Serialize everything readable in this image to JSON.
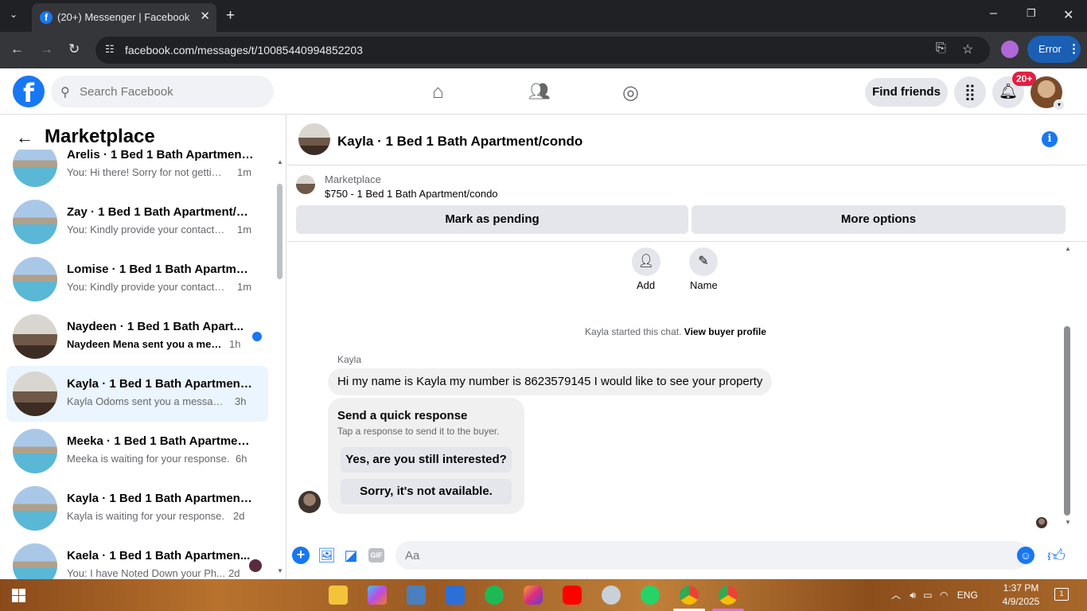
{
  "browser": {
    "tab_title": "(20+) Messenger | Facebook",
    "url": "facebook.com/messages/t/10085440994852203",
    "error_label": "Error"
  },
  "header": {
    "search_placeholder": "Search Facebook",
    "find_friends": "Find friends",
    "notification_badge": "20+"
  },
  "sidebar": {
    "title": "Marketplace",
    "conversations": [
      {
        "name": "Arelis · 1 Bed 1 Bath Apartment/...",
        "snippet": "You: Hi there! Sorry for not getting...",
        "time": "1m",
        "unread": false
      },
      {
        "name": "Zay · 1 Bed 1 Bath Apartment/co...",
        "snippet": "You: Kindly provide your contact n...",
        "time": "1m",
        "unread": false
      },
      {
        "name": "Lomise · 1 Bed 1 Bath Apartment...",
        "snippet": "You: Kindly provide your contact n...",
        "time": "1m",
        "unread": false
      },
      {
        "name": "Naydeen · 1 Bed 1 Bath Apart...",
        "snippet": "Naydeen Mena sent you a mess...",
        "time": "1h",
        "unread": true
      },
      {
        "name": "Kayla · 1 Bed 1 Bath Apartment/c...",
        "snippet": "Kayla Odoms sent you a message a...",
        "time": "3h",
        "unread": false,
        "selected": true
      },
      {
        "name": "Meeka · 1 Bed 1 Bath Apartment...",
        "snippet": "Meeka is waiting for your response.",
        "time": "6h",
        "unread": false
      },
      {
        "name": "Kayla · 1 Bed 1 Bath Apartment/c...",
        "snippet": "Kayla is waiting for your response.",
        "time": "2d",
        "unread": false
      },
      {
        "name": "Kaela · 1 Bed 1 Bath Apartmen...",
        "snippet": "You: I have Noted Down your Ph...",
        "time": "2d",
        "unread": false
      }
    ]
  },
  "chat": {
    "title": "Kayla · 1 Bed 1 Bath Apartment/condo",
    "listing_label": "Marketplace",
    "listing_price": "$750 - 1 Bed 1 Bath Apartment/condo",
    "mark_pending": "Mark as pending",
    "more_options": "More options",
    "add_label": "Add",
    "name_label": "Name",
    "started_text": "Kayla started this chat.",
    "view_profile": "View buyer profile",
    "sender": "Kayla",
    "message": "Hi my name is Kayla  my number is 8623579145 I would like to see your property",
    "quick_title": "Send a quick response",
    "quick_subtitle": "Tap a response to send it to the buyer.",
    "quick_reply_1": "Yes, are you still interested?",
    "quick_reply_2": "Sorry, it's not available.",
    "input_placeholder": "Aa"
  },
  "taskbar": {
    "language": "ENG",
    "time": "1:37 PM",
    "date": "4/9/2025",
    "notification_count": "1"
  },
  "colors": {
    "brand": "#1877f2",
    "selected_row": "#ebf5ff",
    "badge": "#e41e3f"
  }
}
